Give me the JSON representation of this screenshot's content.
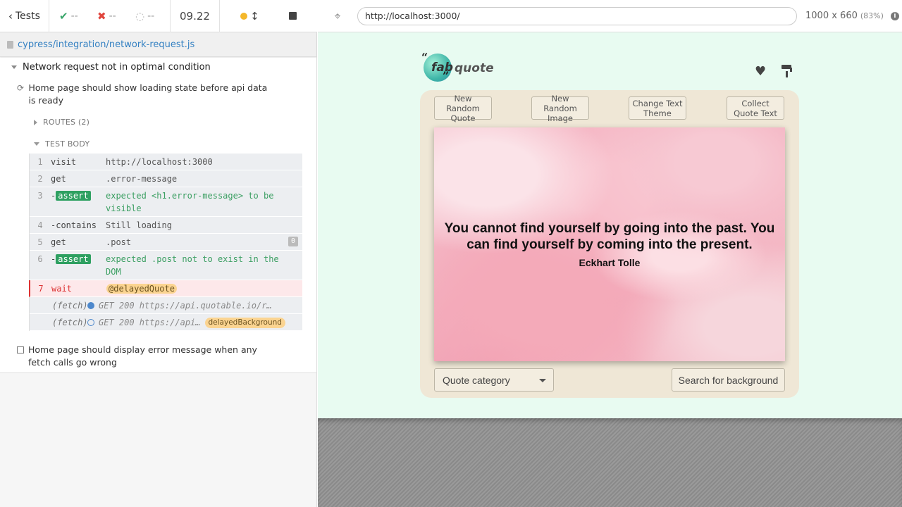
{
  "topbar": {
    "tests_label": "Tests",
    "passed": "--",
    "failed": "--",
    "pending": "--",
    "duration": "09.22"
  },
  "spec": {
    "path": "cypress/integration/network-request.js"
  },
  "suite": {
    "title": "Network request not in optimal condition",
    "test1_title": "Home page should show loading state before api data is ready",
    "routes_label": "ROUTES (2)",
    "test_body_label": "TEST BODY",
    "test2_title": "Home page should display error message when any fetch calls go wrong"
  },
  "commands": [
    {
      "num": "1",
      "name": "visit",
      "msg": "http://localhost:3000"
    },
    {
      "num": "2",
      "name": "get",
      "msg": ".error-message"
    },
    {
      "num": "3",
      "name": "-",
      "badge": "assert",
      "msg": "expected  <h1.error-message>  to be visible"
    },
    {
      "num": "4",
      "name": "-contains",
      "msg": "Still loading"
    },
    {
      "num": "5",
      "name": "get",
      "msg": ".post",
      "count": "0"
    },
    {
      "num": "6",
      "name": "-",
      "badge": "assert",
      "msg": "expected  .post  not to exist in the DOM"
    },
    {
      "num": "7",
      "name": "wait",
      "alias": "@delayedQuote"
    },
    {
      "name": "(fetch)",
      "msg": "GET 200 https://api.quotable.io/r…"
    },
    {
      "name": "(fetch)",
      "msg": "GET 200 https://api…",
      "alias": "delayedBackground"
    }
  ],
  "aut": {
    "url": "http://localhost:3000/",
    "viewport": "1000 x 660",
    "scale": "(83%)"
  },
  "app": {
    "logo_fab": "fab",
    "logo_quote": "quote",
    "buttons": [
      "New Random Quote",
      "New Random Image",
      "Change Text Theme",
      "Collect Quote Text"
    ],
    "quote": "You cannot find yourself by going into the past. You can find yourself by coming into the present.",
    "author": "Eckhart Tolle",
    "category_placeholder": "Quote category",
    "search_background": "Search for background"
  },
  "colors": {
    "aut_bg": "#e8fbf1",
    "card_bg": "#efe7d6",
    "assert_green": "#2ea061",
    "alias_yellow": "#fbd491",
    "link_blue": "#3380c2"
  },
  "icons": [
    "chevron-left-icon",
    "check-icon",
    "x-icon",
    "circle-notch-icon",
    "crosshair-icon",
    "heart-icon",
    "paint-roller-icon",
    "info-icon"
  ]
}
